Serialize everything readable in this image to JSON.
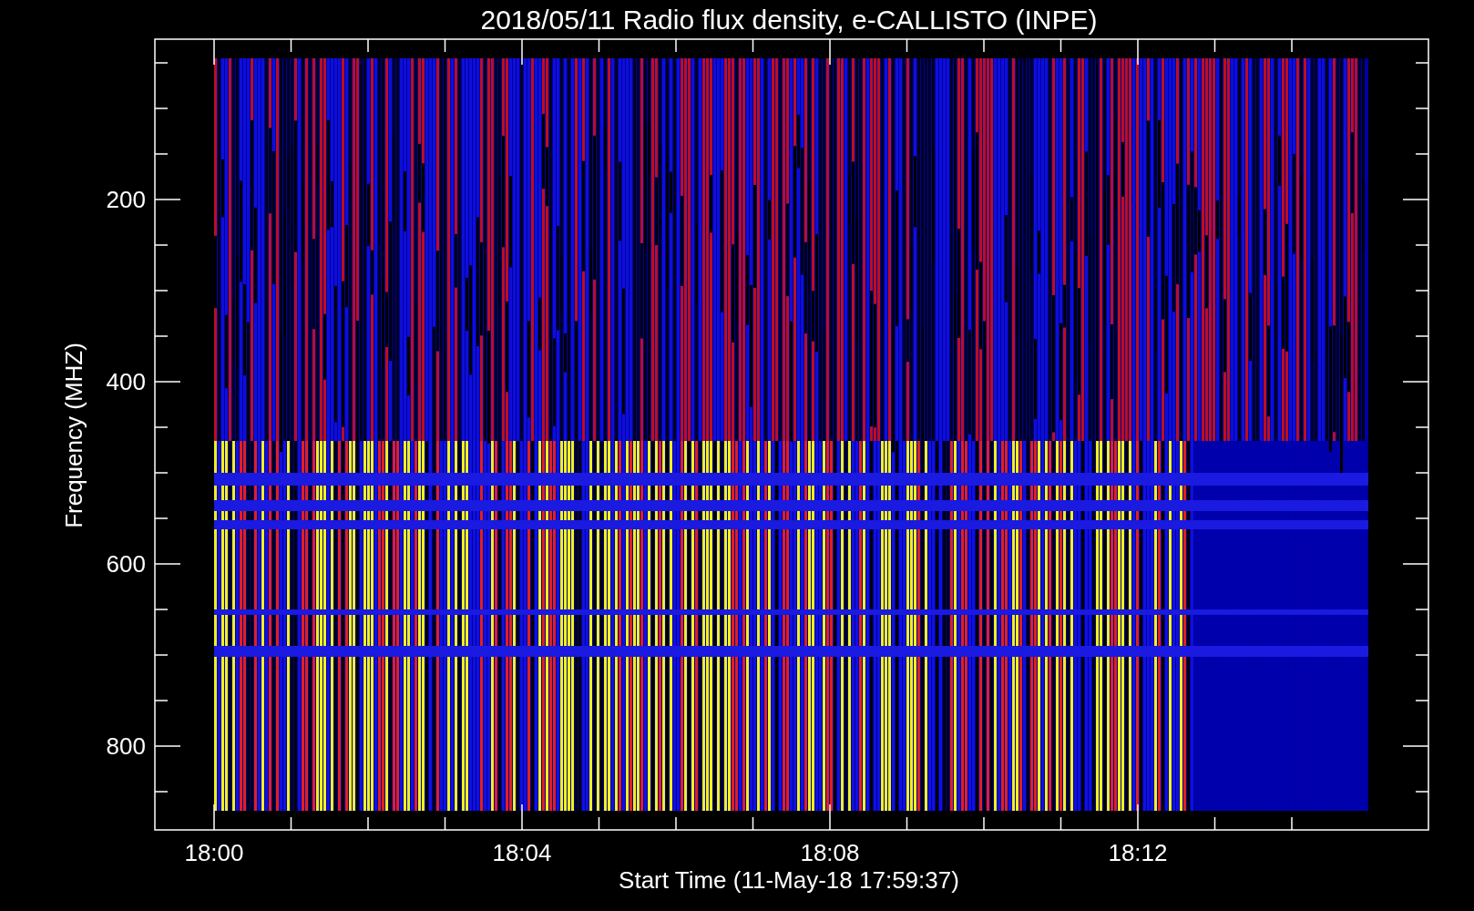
{
  "title": "2018/05/11  Radio flux density, e-CALLISTO (INPE)",
  "y_axis": {
    "label": "Frequency (MHZ)",
    "ticks": [
      "200",
      "400",
      "600",
      "800"
    ]
  },
  "x_axis": {
    "label": "Start Time (11-May-18 17:59:37)",
    "ticks": [
      "18:00",
      "18:04",
      "18:08",
      "18:12"
    ]
  }
}
